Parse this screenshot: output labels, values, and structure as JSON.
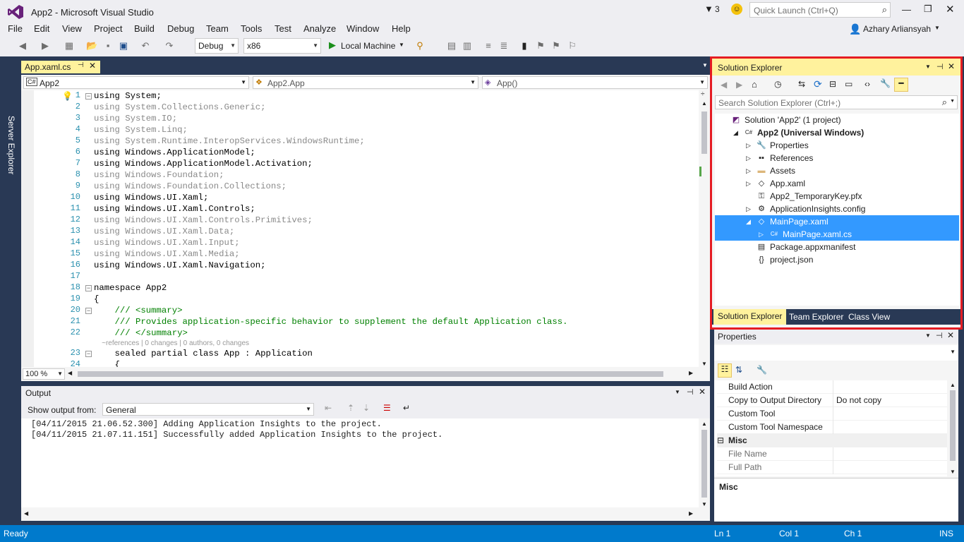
{
  "window": {
    "title": "App2 - Microsoft Visual Studio",
    "filter_count": "3",
    "quick_launch_placeholder": "Quick Launch (Ctrl+Q)",
    "user": "Azhary Arliansyah"
  },
  "menu": [
    "File",
    "Edit",
    "View",
    "Project",
    "Build",
    "Debug",
    "Team",
    "Tools",
    "Test",
    "Analyze",
    "Window",
    "Help"
  ],
  "toolbar": {
    "config": "Debug",
    "platform": "x86",
    "run_target": "Local Machine"
  },
  "left_strip": {
    "label": "Server Explorer"
  },
  "editor": {
    "tab": "App.xaml.cs",
    "nav": {
      "project": "App2",
      "class": "App2.App",
      "member": "App()"
    },
    "zoom": "100 %",
    "code_lines": [
      {
        "n": "1",
        "text": "using System;",
        "style": "using"
      },
      {
        "n": "2",
        "text": "using System.Collections.Generic;",
        "style": "gray"
      },
      {
        "n": "3",
        "text": "using System.IO;",
        "style": "gray"
      },
      {
        "n": "4",
        "text": "using System.Linq;",
        "style": "gray"
      },
      {
        "n": "5",
        "text": "using System.Runtime.InteropServices.WindowsRuntime;",
        "style": "gray"
      },
      {
        "n": "6",
        "text": "using Windows.ApplicationModel;",
        "style": "using"
      },
      {
        "n": "7",
        "text": "using Windows.ApplicationModel.Activation;",
        "style": "using"
      },
      {
        "n": "8",
        "text": "using Windows.Foundation;",
        "style": "gray"
      },
      {
        "n": "9",
        "text": "using Windows.Foundation.Collections;",
        "style": "gray"
      },
      {
        "n": "10",
        "text": "using Windows.UI.Xaml;",
        "style": "using"
      },
      {
        "n": "11",
        "text": "using Windows.UI.Xaml.Controls;",
        "style": "using"
      },
      {
        "n": "12",
        "text": "using Windows.UI.Xaml.Controls.Primitives;",
        "style": "gray"
      },
      {
        "n": "13",
        "text": "using Windows.UI.Xaml.Data;",
        "style": "gray"
      },
      {
        "n": "14",
        "text": "using Windows.UI.Xaml.Input;",
        "style": "gray"
      },
      {
        "n": "15",
        "text": "using Windows.UI.Xaml.Media;",
        "style": "gray"
      },
      {
        "n": "16",
        "text": "using Windows.UI.Xaml.Navigation;",
        "style": "using"
      },
      {
        "n": "17",
        "text": "",
        "style": "plain"
      },
      {
        "n": "18",
        "text": "namespace App2",
        "style": "ns"
      },
      {
        "n": "19",
        "text": "{",
        "style": "plain"
      },
      {
        "n": "20",
        "text": "    /// <summary>",
        "style": "doc"
      },
      {
        "n": "21",
        "text": "    /// Provides application-specific behavior to supplement the default Application class.",
        "style": "doc"
      },
      {
        "n": "22",
        "text": "    /// </summary>",
        "style": "doc"
      },
      {
        "n": "",
        "text": "    ~references | 0 changes | 0 authors, 0 changes",
        "style": "lens"
      },
      {
        "n": "23",
        "text": "    sealed partial class App : Application",
        "style": "class"
      },
      {
        "n": "24",
        "text": "    {",
        "style": "plain"
      }
    ]
  },
  "output": {
    "title": "Output",
    "show_from_label": "Show output from:",
    "source": "General",
    "lines": [
      "[04/11/2015 21.06.52.300] Adding Application Insights to the project.",
      "[04/11/2015 21.07.11.151] Successfully added Application Insights to the project."
    ]
  },
  "solution_explorer": {
    "title": "Solution Explorer",
    "search_placeholder": "Search Solution Explorer (Ctrl+;)",
    "items": [
      {
        "label": "Solution 'App2' (1 project)",
        "level": 0,
        "arrow": "",
        "bold": false,
        "selected": false,
        "icon": "solution-icon"
      },
      {
        "label": "App2 (Universal Windows)",
        "level": 1,
        "arrow": "◢",
        "bold": true,
        "selected": false,
        "icon": "csharp-project-icon"
      },
      {
        "label": "Properties",
        "level": 2,
        "arrow": "▷",
        "bold": false,
        "selected": false,
        "icon": "wrench-icon"
      },
      {
        "label": "References",
        "level": 2,
        "arrow": "▷",
        "bold": false,
        "selected": false,
        "icon": "references-icon"
      },
      {
        "label": "Assets",
        "level": 2,
        "arrow": "▷",
        "bold": false,
        "selected": false,
        "icon": "folder-icon"
      },
      {
        "label": "App.xaml",
        "level": 2,
        "arrow": "▷",
        "bold": false,
        "selected": false,
        "icon": "xaml-file-icon"
      },
      {
        "label": "App2_TemporaryKey.pfx",
        "level": 2,
        "arrow": "",
        "bold": false,
        "selected": false,
        "icon": "key-file-icon"
      },
      {
        "label": "ApplicationInsights.config",
        "level": 2,
        "arrow": "▷",
        "bold": false,
        "selected": false,
        "icon": "config-file-icon"
      },
      {
        "label": "MainPage.xaml",
        "level": 2,
        "arrow": "◢",
        "bold": false,
        "selected": true,
        "icon": "xaml-file-icon"
      },
      {
        "label": "MainPage.xaml.cs",
        "level": 3,
        "arrow": "▷",
        "bold": false,
        "selected": true,
        "icon": "csharp-file-icon"
      },
      {
        "label": "Package.appxmanifest",
        "level": 2,
        "arrow": "",
        "bold": false,
        "selected": false,
        "icon": "manifest-file-icon"
      },
      {
        "label": "project.json",
        "level": 2,
        "arrow": "",
        "bold": false,
        "selected": false,
        "icon": "json-file-icon"
      }
    ],
    "tabs": [
      "Solution Explorer",
      "Team Explorer",
      "Class View"
    ]
  },
  "properties": {
    "title": "Properties",
    "rows": [
      {
        "name": "Build Action",
        "value": "",
        "type": "row"
      },
      {
        "name": "Copy to Output Directory",
        "value": "Do not copy",
        "type": "row"
      },
      {
        "name": "Custom Tool",
        "value": "",
        "type": "row"
      },
      {
        "name": "Custom Tool Namespace",
        "value": "",
        "type": "row"
      },
      {
        "name": "Misc",
        "value": "",
        "type": "category"
      },
      {
        "name": "File Name",
        "value": "",
        "type": "gray"
      },
      {
        "name": "Full Path",
        "value": "",
        "type": "gray"
      }
    ],
    "description_title": "Misc"
  },
  "status": {
    "state": "Ready",
    "line": "Ln 1",
    "col": "Col 1",
    "ch": "Ch 1",
    "mode": "INS"
  },
  "colors": {
    "accent": "#007acc",
    "highlight_border": "#e51c23",
    "selection": "#3399ff",
    "active_tab_bg": "#fff29d"
  }
}
